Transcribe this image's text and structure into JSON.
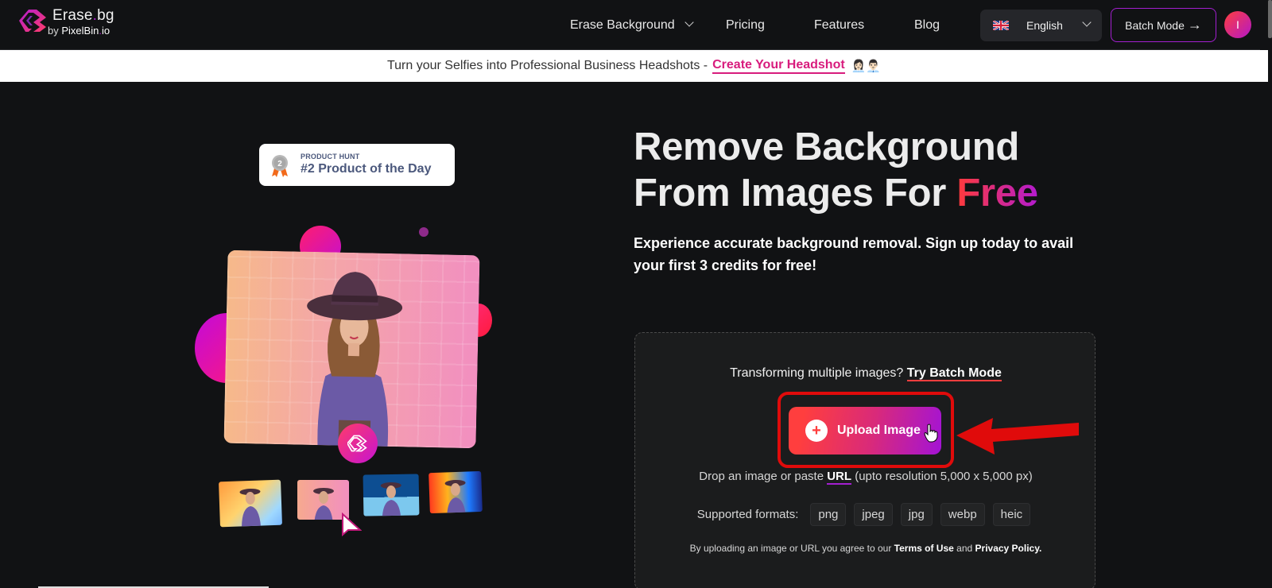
{
  "header": {
    "logo_title_pre": "Erase",
    "logo_title_dot": ".",
    "logo_title_post": "bg",
    "logo_sub_by": "by ",
    "logo_sub_brand": "PixelBin",
    "logo_sub_dot": ".",
    "logo_sub_tld": "io",
    "nav": [
      {
        "label": "Erase Background",
        "has_dropdown": true
      },
      {
        "label": "Pricing"
      },
      {
        "label": "Features"
      },
      {
        "label": "Blog"
      }
    ],
    "language": {
      "label": "English",
      "flag": "uk-flag-icon"
    },
    "batch_mode_label": "Batch Mode",
    "batch_mode_arrow": "→",
    "avatar_initial": "I"
  },
  "banner": {
    "text": "Turn your Selfies into Professional Business Headshots - ",
    "link": "Create Your Headshot",
    "emoji": "👩🏻‍💼👨🏻‍💼"
  },
  "visual": {
    "badge_small": "PRODUCT HUNT",
    "badge_big": "#2 Product of the Day",
    "badge_rank": "2"
  },
  "hero": {
    "title_line1": "Remove Background",
    "title_line2_pre": "From Images For ",
    "title_line2_accent": "Free",
    "subtitle": "Experience accurate background removal. Sign up today to avail your first 3 credits for free!"
  },
  "upload": {
    "batch_prompt": "Transforming multiple images? ",
    "batch_link": "Try Batch Mode",
    "button_label": "Upload Image",
    "drop_pre": "Drop an image or paste ",
    "drop_link": "URL",
    "drop_post": " (upto resolution 5,000 x 5,000 px)",
    "formats_label": "Supported formats:",
    "formats": [
      "png",
      "jpeg",
      "jpg",
      "webp",
      "heic"
    ],
    "terms_pre": "By uploading an image or URL you agree to our ",
    "terms_link": "Terms of Use",
    "terms_mid": " and ",
    "privacy_link": "Privacy Policy."
  },
  "colors": {
    "accent_red": "#ff3e3e",
    "accent_purple": "#a313d6",
    "banner_link": "#d81c7d",
    "annotation_red": "#e00b0b"
  }
}
